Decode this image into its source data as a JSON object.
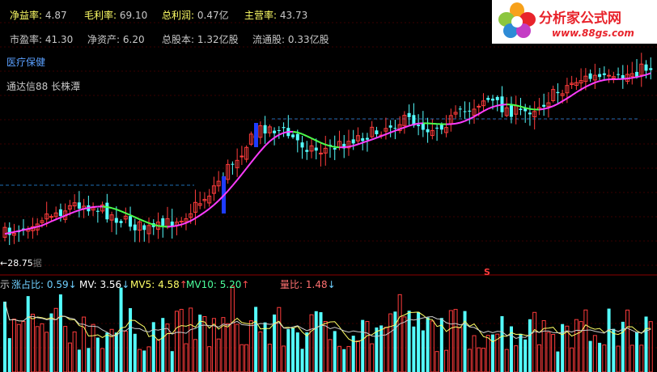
{
  "fundamentals": {
    "row1": [
      {
        "label": "净益率:",
        "value": "4.87"
      },
      {
        "label": "毛利率:",
        "value": "69.10"
      },
      {
        "label": "总利润:",
        "value": "0.47亿"
      },
      {
        "label": "主营率:",
        "value": "43.73"
      }
    ],
    "row2": [
      {
        "label": "市盈率:",
        "value": "41.30"
      },
      {
        "label": "净资产:",
        "value": "6.20"
      },
      {
        "label": "总股本:",
        "value": "1.32亿股"
      },
      {
        "label": "流通股:",
        "value": "0.33亿股"
      }
    ]
  },
  "sector": "医疗保健",
  "source_note": "通达信88 长株潭",
  "price_low_label": "←28.75",
  "price_low_suffix": "据",
  "volume_panel": {
    "left_marker": "示",
    "items": [
      {
        "label": "涨占比:",
        "value": "0.59",
        "arrow": "↓"
      },
      {
        "label": "MV:",
        "value": "3.56",
        "arrow": "↓"
      },
      {
        "label": "MV5:",
        "value": "4.58",
        "arrow": "↑"
      },
      {
        "label": "MV10:",
        "value": "5.20",
        "arrow": "↑"
      },
      {
        "label": "量比:",
        "value": "1.48",
        "arrow": "↓"
      }
    ]
  },
  "signal_marker": "S",
  "logo": {
    "brand": "分析家公式网",
    "url": "www.88gs.com"
  },
  "colors": {
    "up": "#ff3c3c",
    "down": "#54ffff",
    "ma_rise": "#ff3cff",
    "ma_fall": "#4cff4c",
    "dash": "#1e6eb4",
    "vol_ma": "#ffff66",
    "vol_ma2": "#cccccc"
  },
  "chart_data": {
    "type": "candlestick",
    "close_trend": [
      28.8,
      29.5,
      30.4,
      30.9,
      31.6,
      31.2,
      30.3,
      29.6,
      29.1,
      29.9,
      30.8,
      32.4,
      34.6,
      36.8,
      38.6,
      38.2,
      37.1,
      36.4,
      36.8,
      37.6,
      38.0,
      38.9,
      39.2,
      38.4,
      39.1,
      40.0,
      41.2,
      40.3,
      39.8,
      40.6,
      41.8,
      42.9,
      43.1,
      42.7,
      43.6,
      44.1
    ],
    "volume_ratio": [
      0.59,
      1.48
    ],
    "volume_ma": [
      3.56,
      4.58,
      5.2
    ]
  }
}
